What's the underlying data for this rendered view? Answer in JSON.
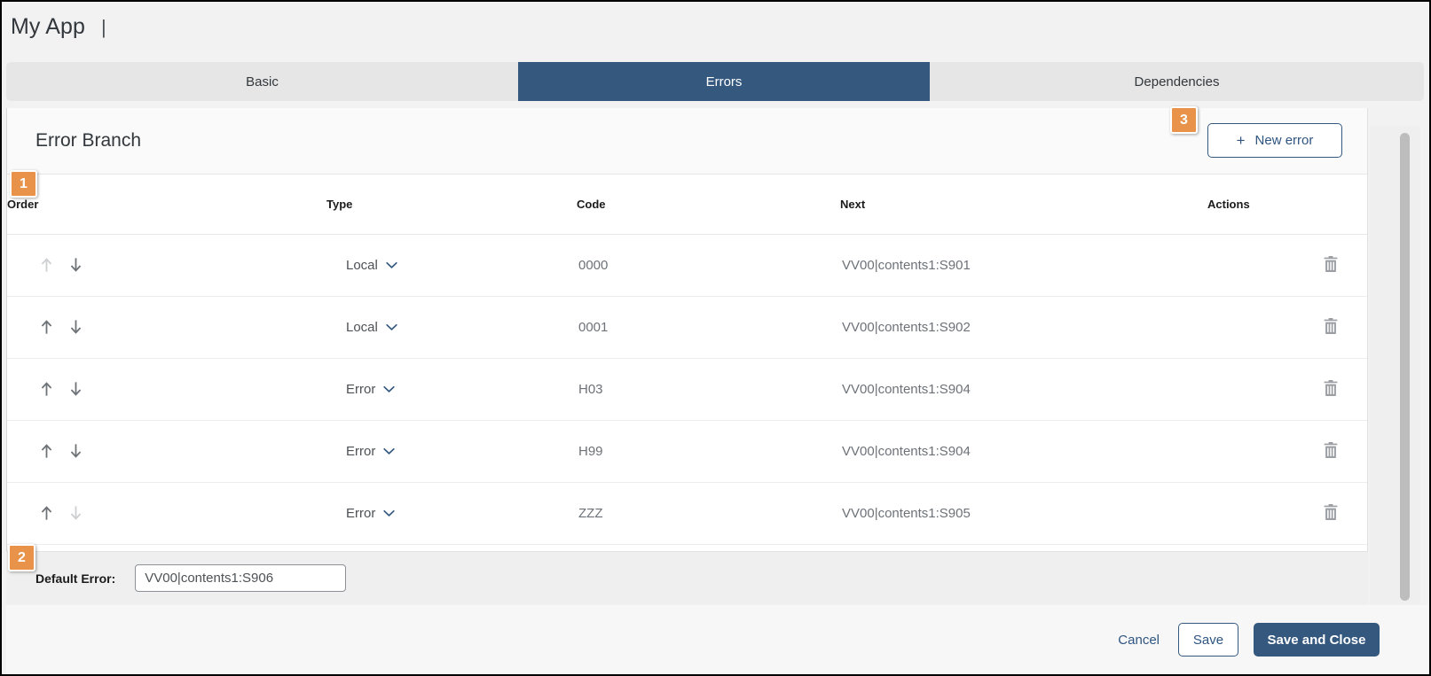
{
  "window": {
    "title": "My App",
    "title_separator": "|"
  },
  "colors": {
    "accent_blue": "#35587f",
    "badge_orange": "#e8924a",
    "tab_inactive_bg": "#e6e6e6",
    "panel_bg": "#ffffff",
    "footer_bg": "#f7f7f7",
    "default_bar_bg": "#efefef",
    "text_muted": "#6d7278"
  },
  "tabs": [
    {
      "label": "Basic",
      "active": false
    },
    {
      "label": "Errors",
      "active": true
    },
    {
      "label": "Dependencies",
      "active": false
    }
  ],
  "panel": {
    "title": "Error Branch",
    "new_error_label": "New error",
    "new_error_icon": "plus-icon"
  },
  "table": {
    "columns": [
      "Order",
      "Type",
      "Code",
      "Next",
      "Actions"
    ],
    "rows": [
      {
        "type": "Local",
        "code": "0000",
        "next": "VV00|contents1:S901",
        "up_enabled": false,
        "down_enabled": true
      },
      {
        "type": "Local",
        "code": "0001",
        "next": "VV00|contents1:S902",
        "up_enabled": true,
        "down_enabled": true
      },
      {
        "type": "Error",
        "code": "H03",
        "next": "VV00|contents1:S904",
        "up_enabled": true,
        "down_enabled": true
      },
      {
        "type": "Error",
        "code": "H99",
        "next": "VV00|contents1:S904",
        "up_enabled": true,
        "down_enabled": true
      },
      {
        "type": "Error",
        "code": "ZZZ",
        "next": "VV00|contents1:S905",
        "up_enabled": true,
        "down_enabled": false
      }
    ],
    "type_options": [
      "Local",
      "Error"
    ],
    "icons": {
      "move_up": "arrow-up-icon",
      "move_down": "arrow-down-icon",
      "delete": "trash-icon",
      "dropdown": "chevron-down-icon"
    }
  },
  "default_error": {
    "label": "Default Error:",
    "value": "VV00|contents1:S906",
    "placeholder": ""
  },
  "footer": {
    "cancel_label": "Cancel",
    "save_label": "Save",
    "save_close_label": "Save and Close"
  },
  "callouts": [
    {
      "number": "1",
      "target": "order-column-header"
    },
    {
      "number": "2",
      "target": "default-error-field"
    },
    {
      "number": "3",
      "target": "new-error-button"
    }
  ]
}
